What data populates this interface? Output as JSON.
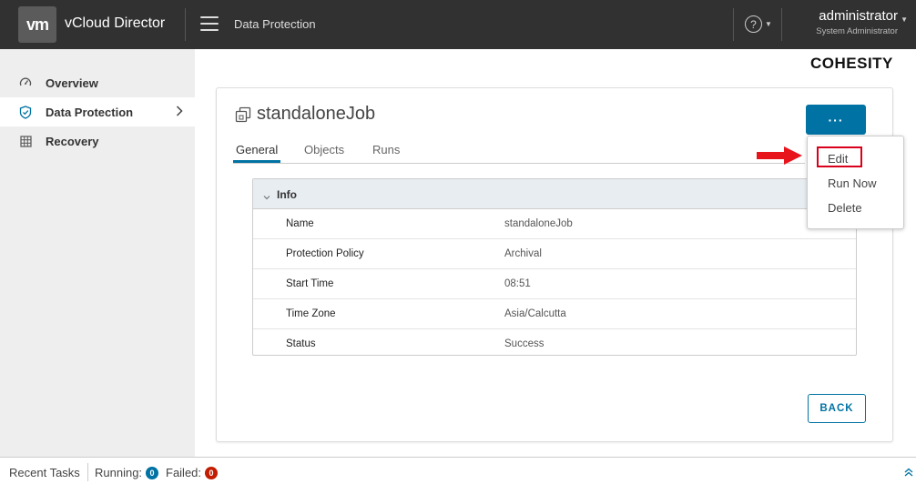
{
  "header": {
    "logo_text": "vm",
    "app_title": "vCloud Director",
    "section": "Data Protection",
    "help_glyph": "?",
    "user_name": "administrator",
    "user_role": "System Administrator"
  },
  "sidebar": {
    "items": [
      {
        "label": "Overview",
        "icon": "dashboard-icon"
      },
      {
        "label": "Data Protection",
        "icon": "shield-icon",
        "active": true
      },
      {
        "label": "Recovery",
        "icon": "grid-icon"
      }
    ]
  },
  "main": {
    "brand": "COHESITY",
    "job_title": "standaloneJob",
    "actions_label": "···",
    "tabs": [
      {
        "label": "General",
        "active": true
      },
      {
        "label": "Objects"
      },
      {
        "label": "Runs"
      }
    ],
    "info": {
      "title": "Info",
      "rows": [
        {
          "key": "Name",
          "value": "standaloneJob"
        },
        {
          "key": "Protection Policy",
          "value": "Archival"
        },
        {
          "key": "Start Time",
          "value": "08:51"
        },
        {
          "key": "Time Zone",
          "value": "Asia/Calcutta"
        },
        {
          "key": "Status",
          "value": "Success"
        }
      ]
    },
    "back_label": "BACK"
  },
  "dropdown": {
    "items": [
      "Edit",
      "Run Now",
      "Delete"
    ]
  },
  "footer": {
    "recent_tasks": "Recent Tasks",
    "running_label": "Running:",
    "running_count": "0",
    "failed_label": "Failed:",
    "failed_count": "0"
  },
  "colors": {
    "header_bg": "#313131",
    "primary": "#0072a3",
    "highlight": "#d9001b",
    "failed_badge": "#c21d00"
  }
}
